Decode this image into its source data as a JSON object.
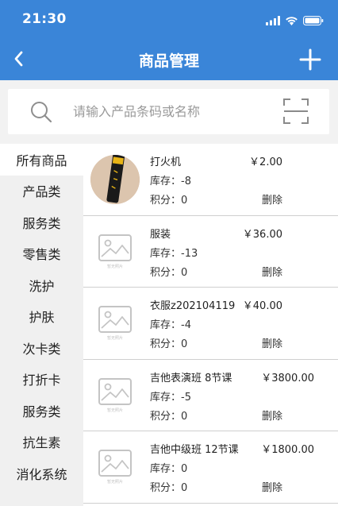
{
  "status_bar": {
    "time": "21:30"
  },
  "nav": {
    "title": "商品管理"
  },
  "search": {
    "placeholder": "请输入产品条码或名称"
  },
  "categories": [
    {
      "label": "所有商品"
    },
    {
      "label": "产品类"
    },
    {
      "label": "服务类"
    },
    {
      "label": "零售类"
    },
    {
      "label": "洗护"
    },
    {
      "label": "护肤"
    },
    {
      "label": "次卡类"
    },
    {
      "label": "打折卡"
    },
    {
      "label": "服务类"
    },
    {
      "label": "抗生素"
    },
    {
      "label": "消化系统"
    }
  ],
  "products": [
    {
      "name": "打火机",
      "price": "￥2.00",
      "stock": "库存：-8",
      "points": "积分：0",
      "delete": "删除",
      "image": "photo"
    },
    {
      "name": "服装",
      "price": "￥36.00",
      "stock": "库存：-13",
      "points": "积分：0",
      "delete": "删除",
      "image": "placeholder",
      "image_caption": "暂无照片"
    },
    {
      "name": "衣服z202104119",
      "price": "￥40.00",
      "stock": "库存：-4",
      "points": "积分：0",
      "delete": "删除",
      "image": "placeholder",
      "image_caption": "暂无照片"
    },
    {
      "name": "吉他表演班 8节课",
      "price": "￥3800.00",
      "stock": "库存：-5",
      "points": "积分：0",
      "delete": "删除",
      "image": "placeholder",
      "image_caption": "暂无照片"
    },
    {
      "name": "吉他中级班 12节课",
      "price": "￥1800.00",
      "stock": "库存：0",
      "points": "积分：0",
      "delete": "删除",
      "image": "placeholder",
      "image_caption": "暂无照片"
    }
  ],
  "colors": {
    "header": "#3a85d8",
    "sidebar": "#f0f0f0",
    "background": "#f2f2f2"
  }
}
